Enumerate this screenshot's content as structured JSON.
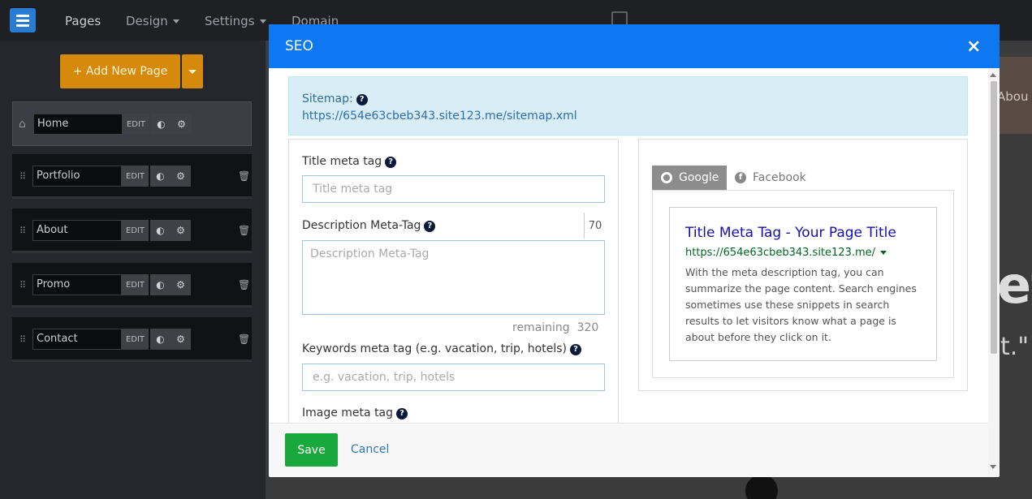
{
  "topbar": {
    "nav": [
      {
        "label": "Pages"
      },
      {
        "label": "Design"
      },
      {
        "label": "Settings"
      },
      {
        "label": "Domain"
      }
    ]
  },
  "sidebar": {
    "add_page_label": "+ Add New Page",
    "pages": [
      {
        "name": "Home",
        "edit": "EDIT"
      },
      {
        "name": "Portfolio",
        "edit": "EDIT"
      },
      {
        "name": "About",
        "edit": "EDIT"
      },
      {
        "name": "Promo",
        "edit": "EDIT"
      },
      {
        "name": "Contact",
        "edit": "EDIT"
      }
    ]
  },
  "background": {
    "nav_fragment": "Abou",
    "big_fragment": "et",
    "quote_fragment": "t.\""
  },
  "modal": {
    "title": "SEO",
    "close": "×",
    "sitemap": {
      "label": "Sitemap:",
      "url": "https://654e63cbeb343.site123.me/sitemap.xml"
    },
    "form": {
      "title_label": "Title meta tag",
      "title_placeholder": "Title meta tag",
      "title_counter": "70",
      "description_label": "Description Meta-Tag",
      "description_placeholder": "Description Meta-Tag",
      "remaining": "remaining  320",
      "keywords_label": "Keywords meta tag (e.g. vacation, trip, hotels)",
      "keywords_placeholder": "e.g. vacation, trip, hotels",
      "image_label": "Image meta tag"
    },
    "preview": {
      "tab_google": "Google",
      "tab_facebook": "Facebook",
      "title": "Title Meta Tag - Your Page Title",
      "url": "https://654e63cbeb343.site123.me/",
      "description": "With the meta description tag, you can summarize the page content. Search engines sometimes use these snippets in search results to let visitors know what a page is about before they click on it."
    },
    "footer": {
      "save": "Save",
      "cancel": "Cancel"
    }
  },
  "colors": {
    "header_blue": "#0d78f2",
    "save_green": "#19a83b",
    "add_page_orange": "#d68a0c",
    "google_title": "#1a0dab",
    "google_url": "#006621"
  }
}
